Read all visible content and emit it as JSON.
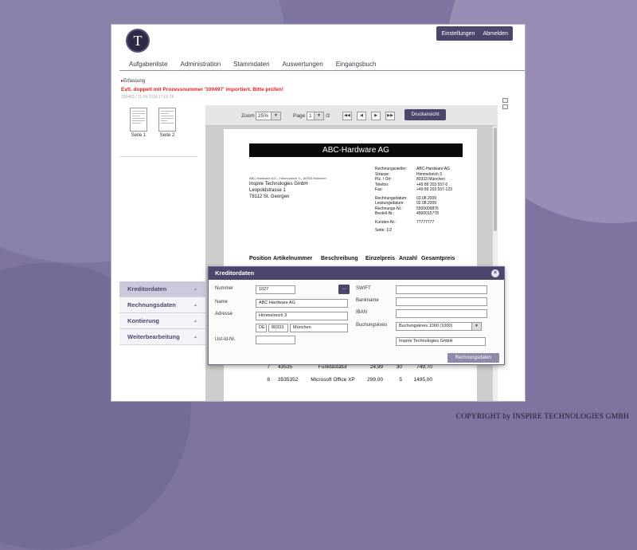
{
  "copyright": "COPYRIGHT by INSPIRE TECHNOLOGIES GMBH",
  "header": {
    "logo_glyph": "T",
    "settings_label": "Einstellungen",
    "logout_label": "Abmelden"
  },
  "nav": [
    "Aufgabenliste",
    "Administration",
    "Stammdaten",
    "Auswertungen",
    "Eingangsbuch"
  ],
  "breadcrumb": "Erfassung",
  "warning": "Evtl. doppelt mit Prozessnummer '100497' importiert. Bitte prüfen!",
  "meta": "100483 / 11.04.2018 17:01:28",
  "thumbnails": [
    "Seite 1",
    "Seite 2"
  ],
  "accordion": [
    {
      "label": "Kreditordaten",
      "active": true
    },
    {
      "label": "Rechnungsdaten",
      "active": false
    },
    {
      "label": "Kontierung",
      "active": false
    },
    {
      "label": "Weiterbearbeitung",
      "active": false
    }
  ],
  "viewer": {
    "zoom_label": "Zoom",
    "zoom_value": "25%",
    "page_label": "Page",
    "page_value": "1",
    "page_total": "/2",
    "print_label": "Druckansicht"
  },
  "document": {
    "company": "ABC-Hardware AG",
    "sender_line": "ABC-Hardware AG – Himmelreich 3 – 80333 München",
    "recipient": [
      "Inspire Technologies GmbH",
      "Leopoldstrasse 1",
      "78112 St. Georgen"
    ],
    "right_block": [
      {
        "k": "Rechnungssteller:",
        "v": "ABC-Hardware AG"
      },
      {
        "k": "Strasse:",
        "v": "Himmelreich 3"
      },
      {
        "k": "Plz. / Ort:",
        "v": "80333 München"
      },
      {
        "k": "Telefon:",
        "v": "+49 89 203 557-0"
      },
      {
        "k": "Fax:",
        "v": "+49 89 203 557-123"
      },
      {
        "k": "",
        "v": ""
      },
      {
        "k": "Rechnungsdatum:",
        "v": "03.08.2009"
      },
      {
        "k": "Leistungsdatum:",
        "v": "02.08.2009"
      },
      {
        "k": "Rechnungs-Nr.:",
        "v": "5500009876"
      },
      {
        "k": "Bestell-Nr.:",
        "v": "4500015778"
      },
      {
        "k": "",
        "v": ""
      },
      {
        "k": "Kunden-Nr.:",
        "v": "77777777"
      },
      {
        "k": "",
        "v": ""
      },
      {
        "k": "Seite: 1/2",
        "v": ""
      }
    ],
    "table_headers": [
      "Position",
      "Artikelnummer",
      "Beschreibung",
      "Einzelpreis",
      "Anzahl",
      "Gesamtpreis"
    ],
    "rows": [
      [
        "7",
        "43535",
        "Funktastatur",
        "24,99",
        "30",
        "749,70"
      ],
      [
        "8",
        "3535352",
        "Microsoft Office XP",
        "299,00",
        "5",
        "1495,00"
      ]
    ]
  },
  "modal": {
    "title": "Kreditordaten",
    "labels": {
      "nummer": "Nummer",
      "name": "Name",
      "adresse": "Adresse",
      "ustid": "Ust-Id-Nr.",
      "swift": "SWIFT",
      "bankname": "Bankname",
      "iban": "IBAN",
      "buchungskreis": "Buchungskreis"
    },
    "values": {
      "nummer": "1027",
      "name": "ABC Hardware AG",
      "strasse": "Himmelreich 3",
      "land": "DE",
      "plz": "80333",
      "ort": "München",
      "ustid": "",
      "swift": "",
      "bankname": "",
      "iban": "",
      "buchungskreis": "Buchungskreis 1000 (1000)",
      "empfaenger": "Inspire Technologies GmbH"
    },
    "lookup_label": "...",
    "footer_button": "Rechnungsdaten"
  }
}
